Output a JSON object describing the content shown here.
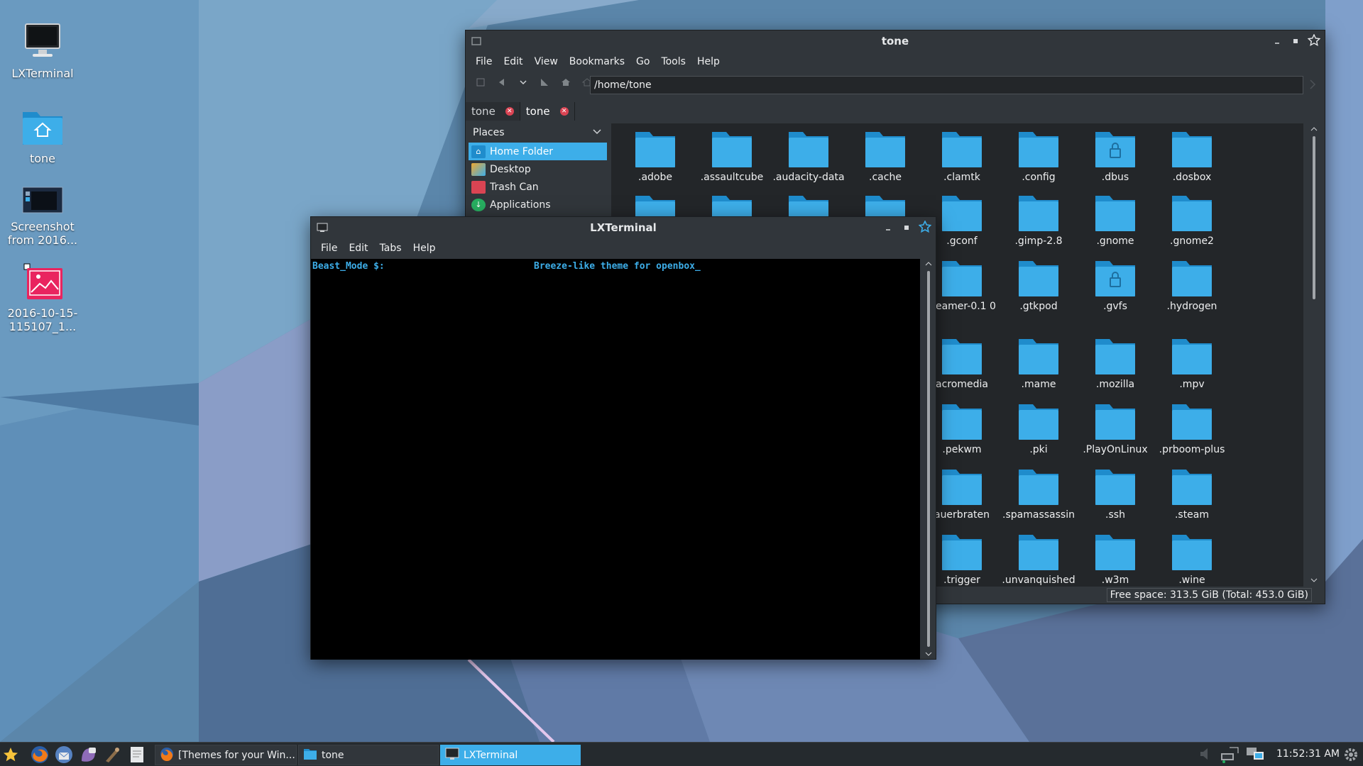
{
  "desktop": {
    "icons": [
      {
        "label": "LXTerminal",
        "icon": "monitor-icon"
      },
      {
        "label": "tone",
        "icon": "home-folder-icon"
      },
      {
        "label": "Screenshot from 2016...",
        "icon": "screenshot-thumbnail-icon"
      },
      {
        "label": "2016-10-15-115107_1...",
        "icon": "image-file-icon"
      }
    ]
  },
  "file_manager": {
    "title": "tone",
    "menu": [
      "File",
      "Edit",
      "View",
      "Bookmarks",
      "Go",
      "Tools",
      "Help"
    ],
    "path": "/home/tone",
    "tabs": [
      {
        "label": "tone",
        "active": false
      },
      {
        "label": "tone",
        "active": true
      }
    ],
    "places_header": "Places",
    "places": [
      {
        "label": "Home Folder",
        "selected": true,
        "color": "#3daee9"
      },
      {
        "label": "Desktop",
        "selected": false,
        "color": "#f0a830"
      },
      {
        "label": "Trash Can",
        "selected": false,
        "color": "#da4453"
      },
      {
        "label": "Applications",
        "selected": false,
        "color": "#27ae60"
      }
    ],
    "files": [
      ".adobe",
      ".assaultcube",
      ".audacity-data",
      ".cache",
      ".clamtk",
      ".config",
      ".dbus",
      ".dosbox",
      "",
      "",
      "",
      "",
      ".gconf",
      ".gimp-2.8",
      ".gnome",
      ".gnome2",
      "",
      "",
      "",
      "",
      "treamer-0.1 0",
      ".gtkpod",
      ".gvfs",
      ".hydrogen",
      "",
      "",
      "",
      "",
      "acromedia",
      ".mame",
      ".mozilla",
      ".mpv",
      "",
      "",
      "",
      "",
      ".pekwm",
      ".pki",
      ".PlayOnLinux",
      ".prboom-plus",
      "",
      "",
      "",
      "",
      "auerbraten",
      ".spamassassin",
      ".ssh",
      ".steam",
      "",
      "",
      "",
      "",
      ".trigger",
      ".unvanquished",
      ".w3m",
      ".wine"
    ],
    "locked": [
      ".dbus",
      ".gvfs"
    ],
    "status": "Free space: 313.5 GiB (Total: 453.0 GiB)"
  },
  "terminal": {
    "title": "LXTerminal",
    "menu": [
      "File",
      "Edit",
      "Tabs",
      "Help"
    ],
    "prompt": "Beast_Mode $:",
    "output": "Breeze-like theme for openbox_"
  },
  "taskbar": {
    "launchers": [
      "menu-star-icon",
      "firefox-icon",
      "thunderbird-icon",
      "pidgin-icon",
      "gimp-icon",
      "text-editor-icon"
    ],
    "tasks": [
      {
        "label": "[Themes for your Win...",
        "icon": "firefox-icon",
        "active": false
      },
      {
        "label": "tone",
        "icon": "folder-icon",
        "active": false
      },
      {
        "label": "LXTerminal",
        "icon": "terminal-icon",
        "active": true
      }
    ],
    "clock": "11:52:31 AM"
  },
  "colors": {
    "accent": "#3daee9",
    "window_bg": "#31363b",
    "view_bg": "#232629",
    "close_red": "#da4453"
  }
}
